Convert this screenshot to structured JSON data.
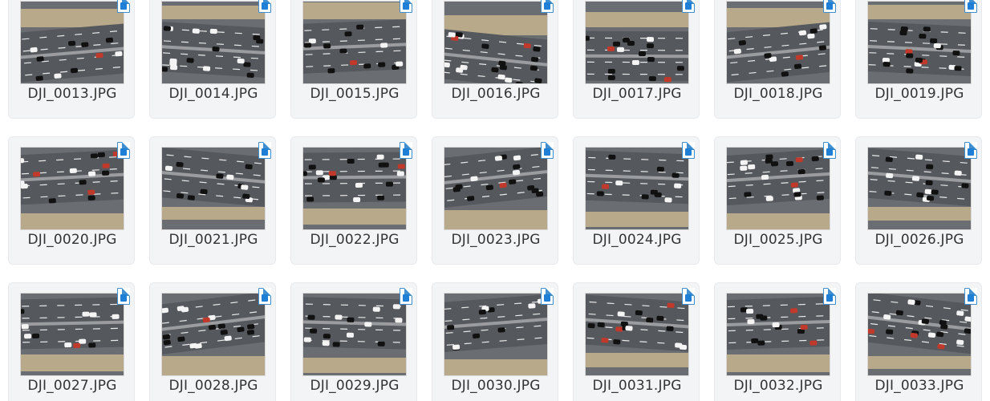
{
  "window": {
    "view": "large-icons",
    "file_icon": "image-file-icon"
  },
  "files": [
    {
      "name": "DJI_0013.JPG"
    },
    {
      "name": "DJI_0014.JPG"
    },
    {
      "name": "DJI_0015.JPG"
    },
    {
      "name": "DJI_0016.JPG"
    },
    {
      "name": "DJI_0017.JPG"
    },
    {
      "name": "DJI_0018.JPG"
    },
    {
      "name": "DJI_0019.JPG"
    },
    {
      "name": "DJI_0020.JPG"
    },
    {
      "name": "DJI_0021.JPG"
    },
    {
      "name": "DJI_0022.JPG"
    },
    {
      "name": "DJI_0023.JPG"
    },
    {
      "name": "DJI_0024.JPG"
    },
    {
      "name": "DJI_0025.JPG"
    },
    {
      "name": "DJI_0026.JPG"
    },
    {
      "name": "DJI_0027.JPG"
    },
    {
      "name": "DJI_0028.JPG"
    },
    {
      "name": "DJI_0029.JPG"
    },
    {
      "name": "DJI_0030.JPG"
    },
    {
      "name": "DJI_0031.JPG"
    },
    {
      "name": "DJI_0032.JPG"
    },
    {
      "name": "DJI_0033.JPG"
    }
  ],
  "colors": {
    "tile_background": "#f3f4f6",
    "badge_accent": "#1f7fd6",
    "road": "#55595e",
    "lane_mark": "#e9e9e9",
    "grass": "#b7a98a"
  }
}
